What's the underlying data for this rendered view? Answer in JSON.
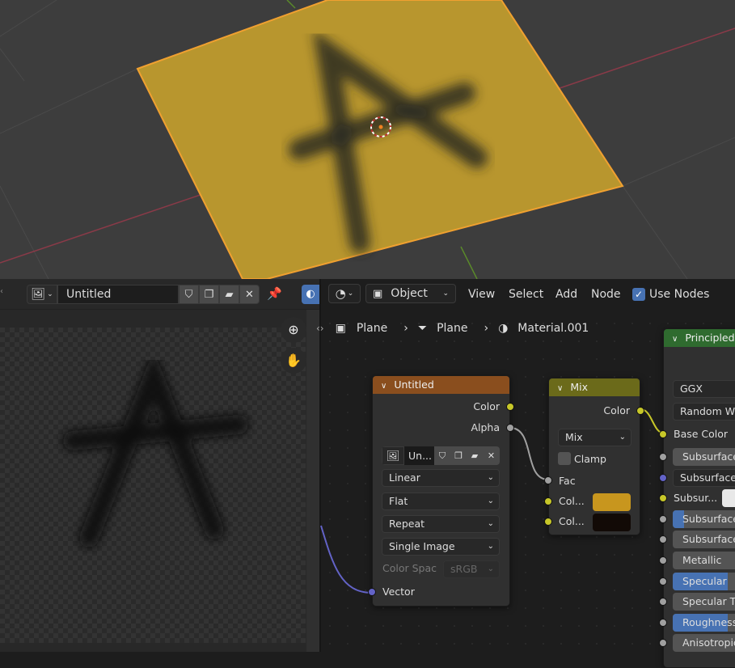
{
  "viewport": {
    "plane_color": "#b8962e",
    "plane_outline": "#f0a030",
    "background": "#3d3d3d"
  },
  "image_editor": {
    "image_type_icon": "image-icon",
    "image_name": "Untitled",
    "icons": [
      "fake-user-shield-icon",
      "duplicate-icon",
      "browse-pack-icon",
      "close-icon",
      "pin-icon"
    ],
    "tools": [
      "zoom-icon",
      "hand-pan-icon"
    ]
  },
  "node_editor": {
    "header": {
      "editor_type_icon": "shader-editor-icon",
      "object_mode": "Object",
      "menus": [
        "View",
        "Select",
        "Add",
        "Node"
      ],
      "use_nodes_label": "Use Nodes",
      "use_nodes_checked": true
    },
    "breadcrumb": [
      "Plane",
      "Plane",
      "Material.001"
    ],
    "image_node": {
      "title": "Untitled",
      "header_color": "#8a4e1e",
      "outputs": [
        "Color",
        "Alpha"
      ],
      "image_name": "Un...",
      "interpolation": "Linear",
      "projection": "Flat",
      "extension": "Repeat",
      "source": "Single Image",
      "color_space_label": "Color Spac",
      "color_space_value": "sRGB",
      "input": "Vector"
    },
    "mix_node": {
      "title": "Mix",
      "header_color": "#6b6a1a",
      "output": "Color",
      "blend_type": "Mix",
      "clamp_label": "Clamp",
      "clamp_checked": false,
      "fac_label": "Fac",
      "color1_label": "Col...",
      "color1": "#c8961e",
      "color2_label": "Col...",
      "color2": "#120a06"
    },
    "principled_node": {
      "title": "Principled",
      "header_color": "#2f6b2f",
      "distribution": "GGX",
      "subsurface_method": "Random Wa",
      "base_color_label": "Base Color",
      "fields": [
        {
          "label": "Subsurface",
          "fill": 0
        },
        {
          "label": "Subsurface R",
          "fill": 0,
          "dropdown": true
        },
        {
          "label": "Subsur...",
          "color": "#e8e8e8"
        },
        {
          "label": "Subsurface",
          "fill": 0.1
        },
        {
          "label": "Subsurface",
          "fill": 0
        },
        {
          "label": "Metallic",
          "fill": 0
        },
        {
          "label": "Specular",
          "fill": 0.5
        },
        {
          "label": "Specular Tint",
          "fill": 0
        },
        {
          "label": "Roughness",
          "fill": 0.5
        },
        {
          "label": "Anisotropic",
          "fill": 0
        }
      ]
    }
  }
}
